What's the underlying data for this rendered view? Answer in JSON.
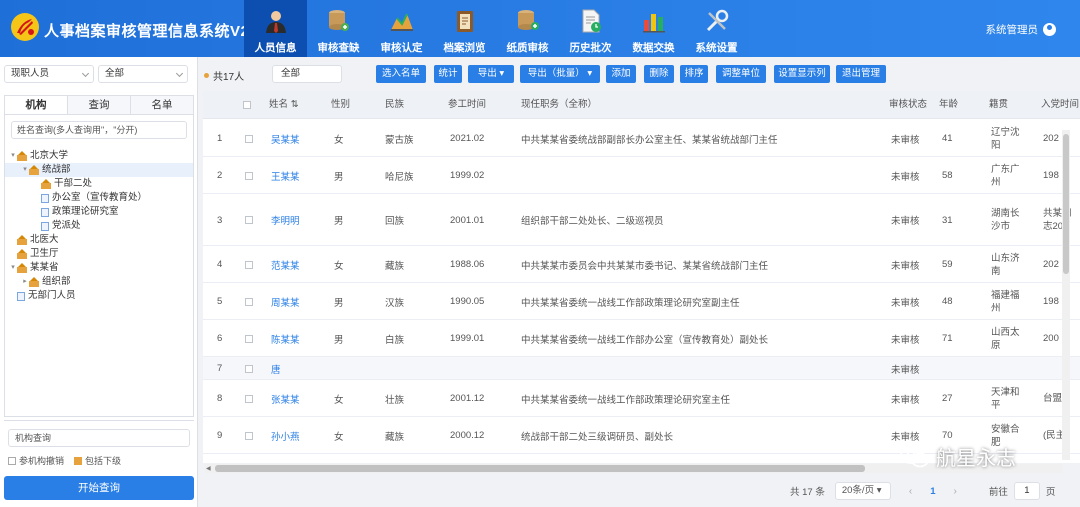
{
  "app": {
    "title": "人事档案审核管理信息系统V2.0",
    "user": "系统管理员"
  },
  "nav": [
    {
      "label": "人员信息",
      "icon": "person-icon",
      "active": true
    },
    {
      "label": "审核查缺",
      "icon": "database-search-icon",
      "active": false
    },
    {
      "label": "审核认定",
      "icon": "chart-mountain-icon",
      "active": false
    },
    {
      "label": "档案浏览",
      "icon": "archive-book-icon",
      "active": false
    },
    {
      "label": "纸质审核",
      "icon": "database-plus-icon",
      "active": false
    },
    {
      "label": "历史批次",
      "icon": "document-clock-icon",
      "active": false
    },
    {
      "label": "数据交换",
      "icon": "bar-chart-icon",
      "active": false
    },
    {
      "label": "系统设置",
      "icon": "tools-icon",
      "active": false
    }
  ],
  "left": {
    "person_type": "现职人员",
    "scope": "全部",
    "tabs": [
      "机构",
      "查询",
      "名单"
    ],
    "name_search_placeholder": "姓名查询(多人查询用\"，\"分开)",
    "tree": [
      {
        "label": "北京大学",
        "level": 0,
        "type": "org",
        "caret": "▾"
      },
      {
        "label": "统战部",
        "level": 1,
        "type": "org",
        "caret": "▾",
        "selected": true
      },
      {
        "label": "干部二处",
        "level": 2,
        "type": "org",
        "caret": ""
      },
      {
        "label": "办公室（宣传教育处）",
        "level": 2,
        "type": "doc",
        "caret": ""
      },
      {
        "label": "政策理论研究室",
        "level": 2,
        "type": "doc",
        "caret": ""
      },
      {
        "label": "党派处",
        "level": 2,
        "type": "doc",
        "caret": ""
      },
      {
        "label": "北医大",
        "level": 0,
        "type": "org",
        "caret": ""
      },
      {
        "label": "卫生厅",
        "level": 0,
        "type": "org",
        "caret": ""
      },
      {
        "label": "某某省",
        "level": 0,
        "type": "org",
        "caret": "▾"
      },
      {
        "label": "组织部",
        "level": 1,
        "type": "org",
        "caret": "▸"
      },
      {
        "label": "无部门人员",
        "level": 0,
        "type": "doc",
        "caret": ""
      }
    ],
    "org_query_placeholder": "机构查询",
    "opt_include_org": "参机构撤销",
    "opt_include_sub": "包括下级",
    "start_button": "开始查询"
  },
  "toolbar": {
    "count": "共17人",
    "range": "全部",
    "buttons": [
      "选入名单",
      "统计",
      "导出",
      "导出（批量）",
      "添加",
      "删除",
      "排序",
      "调整单位",
      "设置显示列",
      "退出管理"
    ]
  },
  "table": {
    "headers": [
      "",
      "姓名",
      "性别",
      "民族",
      "参工时间",
      "现任职务（全称）",
      "审核状态",
      "年龄",
      "籍贯",
      "入党时间"
    ],
    "rows": [
      {
        "no": "1",
        "name": "吴某某",
        "gender": "女",
        "ethnic": "蒙古族",
        "work": "2021.02",
        "position": "中共某某省委统战部副部长办公室主任、某某省统战部门主任",
        "status": "未审核",
        "age": "41",
        "native": "辽宁沈阳",
        "party": "202"
      },
      {
        "no": "2",
        "name": "王某某",
        "gender": "男",
        "ethnic": "哈尼族",
        "work": "1999.02",
        "position": "",
        "status": "未审核",
        "age": "58",
        "native": "广东广州",
        "party": "198"
      },
      {
        "no": "3",
        "name": "李明明",
        "gender": "男",
        "ethnic": "回族",
        "work": "2001.01",
        "position": "组织部干部二处处长、二级巡视员",
        "status": "未审核",
        "age": "31",
        "native": "湖南长沙市",
        "party": "共某同志20."
      },
      {
        "no": "4",
        "name": "范某某",
        "gender": "女",
        "ethnic": "藏族",
        "work": "1988.06",
        "position": "中共某某市委员会中共某某市委书记、某某省统战部门主任",
        "status": "未审核",
        "age": "59",
        "native": "山东济南",
        "party": "202"
      },
      {
        "no": "5",
        "name": "周某某",
        "gender": "男",
        "ethnic": "汉族",
        "work": "1990.05",
        "position": "中共某某省委统一战线工作部政策理论研究室副主任",
        "status": "未审核",
        "age": "48",
        "native": "福建福州",
        "party": "198"
      },
      {
        "no": "6",
        "name": "陈某某",
        "gender": "男",
        "ethnic": "白族",
        "work": "1999.01",
        "position": "中共某某省委统一战线工作部办公室（宣传教育处）副处长",
        "status": "未审核",
        "age": "71",
        "native": "山西太原",
        "party": "200"
      },
      {
        "no": "7",
        "name": "唐",
        "gender": "",
        "ethnic": "",
        "work": "",
        "position": "",
        "status": "未审核",
        "age": "",
        "native": "",
        "party": ""
      },
      {
        "no": "8",
        "name": "张某某",
        "gender": "女",
        "ethnic": "壮族",
        "work": "2001.12",
        "position": "中共某某省委统一战线工作部政策理论研究室主任",
        "status": "未审核",
        "age": "27",
        "native": "天津和平",
        "party": "台盟"
      },
      {
        "no": "9",
        "name": "孙小燕",
        "gender": "女",
        "ethnic": "藏族",
        "work": "2000.12",
        "position": "统战部干部二处三级调研员、副处长",
        "status": "未审核",
        "age": "70",
        "native": "安徽合肥",
        "party": "(民主"
      }
    ]
  },
  "pager": {
    "total": "共 17 条",
    "size": "20条/页",
    "prev": "‹",
    "current": "1",
    "next": "›",
    "goto": "前往",
    "page_value": "1",
    "page_unit": "页"
  },
  "watermark": "航星永志"
}
